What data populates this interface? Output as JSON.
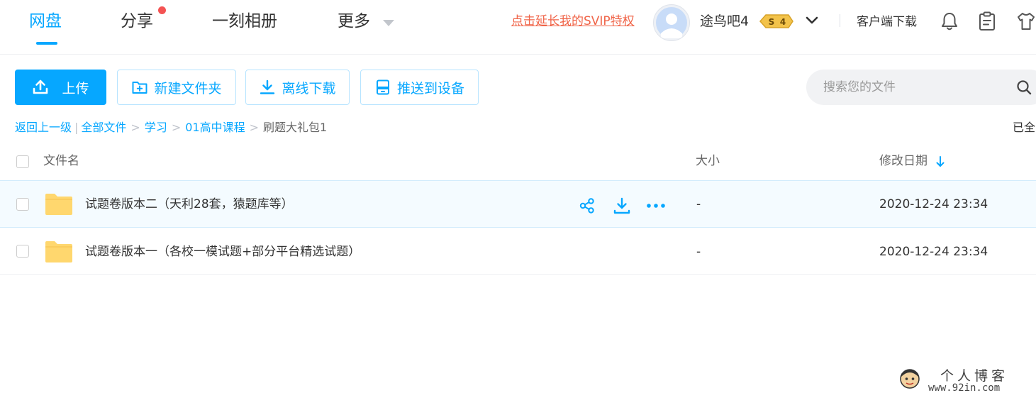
{
  "nav": {
    "tabs": [
      {
        "label": "网盘",
        "active": true
      },
      {
        "label": "分享",
        "has_notification_dot": true
      },
      {
        "label": "一刻相册"
      },
      {
        "label": "更多"
      }
    ],
    "svip_promo": "点击延长我的SVIP特权",
    "username": "途鸟吧4",
    "svip_badge": {
      "letter": "S",
      "level": "4"
    },
    "client_download": "客户端下载",
    "icons": [
      "bell-icon",
      "clipboard-icon",
      "tshirt-icon"
    ]
  },
  "toolbar": {
    "upload_label": "上传",
    "new_folder_label": "新建文件夹",
    "offline_download_label": "离线下载",
    "push_device_label": "推送到设备",
    "search_placeholder": "搜索您的文件"
  },
  "breadcrumb": {
    "back_label": "返回上一级",
    "separator": "|",
    "items": [
      "全部文件",
      "学习",
      "01高中课程"
    ],
    "current": "刷题大礼包1",
    "right_text": "已全"
  },
  "table": {
    "headers": {
      "name": "文件名",
      "size": "大小",
      "modified": "修改日期"
    },
    "sort": {
      "column": "modified",
      "direction": "desc"
    },
    "rows": [
      {
        "name": "试题卷版本二（天利28套，猿题库等）",
        "size": "-",
        "modified": "2020-12-24 23:34",
        "type": "folder",
        "hovered": true
      },
      {
        "name": "试题卷版本一（各校一模试题+部分平台精选试题）",
        "size": "-",
        "modified": "2020-12-24 23:34",
        "type": "folder",
        "hovered": false
      }
    ]
  },
  "colors": {
    "accent": "#06a7ff",
    "promo": "#f06448",
    "folder": "#ffd76e",
    "notification": "#f45353"
  },
  "watermark": {
    "title": "个人博客",
    "url": "www.92in.com"
  }
}
